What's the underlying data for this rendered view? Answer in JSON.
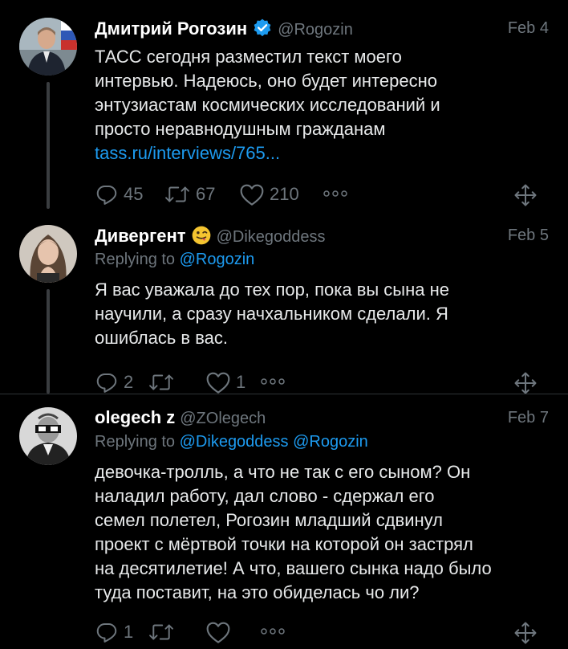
{
  "tweets": [
    {
      "name": "Дмитрий Рогозин",
      "handle": "@Rogozin",
      "date": "Feb 4",
      "verified": true,
      "text_lines": [
        "ТАСС сегодня разместил текст моего",
        "интервью. Надеюсь, оно будет интересно",
        "энтузиастам космических исследований и",
        "просто неравнодушным гражданам"
      ],
      "link": "tass.ru/interviews/765...",
      "replies": "45",
      "retweets": "67",
      "likes": "210"
    },
    {
      "name": "Дивергент",
      "handle": "@Dikegoddess",
      "date": "Feb 5",
      "emoji": "winking-face-with-tongue",
      "replying_label": "Replying to",
      "replying_to": [
        "@Rogozin"
      ],
      "text_lines": [
        "Я вас уважала до тех пор, пока вы сына не",
        "научили, а сразу начхальником сделали. Я",
        "ошиблась в вас."
      ],
      "replies": "2",
      "retweets": "",
      "likes": "1"
    },
    {
      "name": "olegech z",
      "handle": "@ZOlegech",
      "date": "Feb 7",
      "replying_label": "Replying to",
      "replying_to": [
        "@Dikegoddess",
        "@Rogozin"
      ],
      "text_lines": [
        "девочка-тролль, а что не так с его сыном? Он",
        "наладил работу, дал слово - сдержал его",
        "семел полетел, Рогозин младший сдвинул",
        "проект с мёртвой точки на которой он застрял",
        "на десятилетие! А что, вашего сынка надо было",
        "туда поставит, на это обиделась чо ли?"
      ],
      "replies": "1",
      "retweets": "",
      "likes": ""
    }
  ],
  "colors": {
    "background": "#000000",
    "text": "#e7e9ea",
    "secondary": "#6e767d",
    "accent": "#1d9bf0",
    "separator": "#2f3336"
  },
  "icons": {
    "reply": "reply-icon",
    "retweet": "retweet-icon",
    "like": "heart-icon",
    "more": "more-icon",
    "share": "share-icon",
    "verified": "verified-badge-icon"
  }
}
